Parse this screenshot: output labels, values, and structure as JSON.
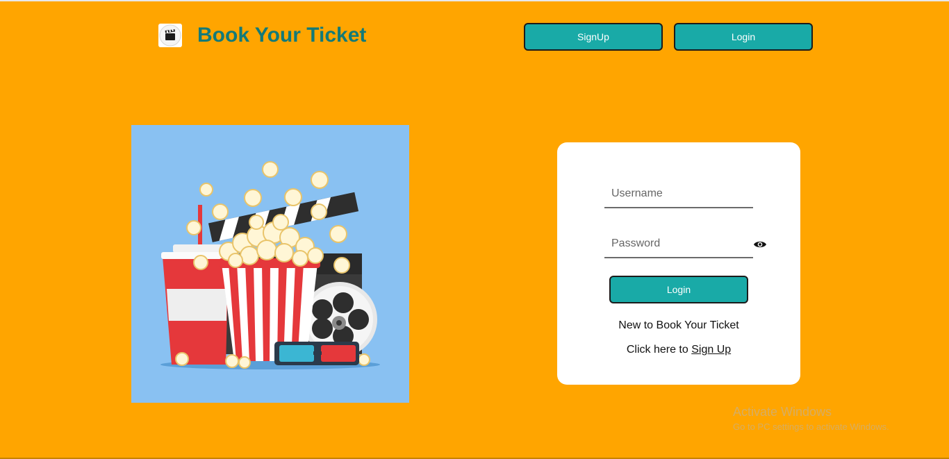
{
  "header": {
    "brand_title": "Book Your Ticket",
    "logo_icon": "clapperboard-icon",
    "signup_label": "SignUp",
    "login_label": "Login"
  },
  "hero": {
    "image": "cinema-snacks-illustration"
  },
  "login_card": {
    "username_placeholder": "Username",
    "username_value": "",
    "password_placeholder": "Password",
    "password_value": "",
    "show_password_icon": "eye-icon",
    "submit_label": "Login",
    "new_text": "New to Book Your Ticket",
    "click_here_text": "Click here to",
    "signup_link_label": "Sign Up"
  },
  "watermark": {
    "title": "Activate Windows",
    "subtitle": "Go to PC settings to activate Windows."
  },
  "colors": {
    "page_background": "#FFA500",
    "accent": "#19AAA7",
    "brand_text": "#137A78",
    "card_background": "#FFFFFF"
  }
}
